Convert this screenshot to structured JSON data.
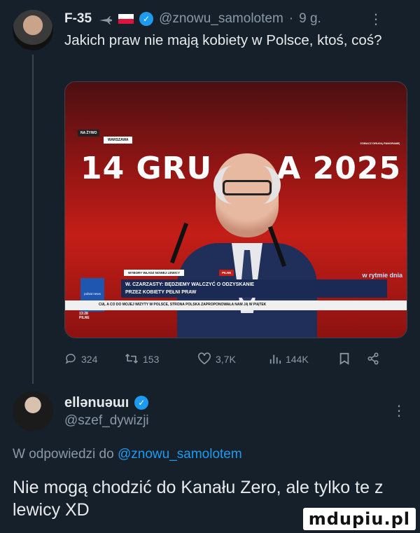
{
  "tweet": {
    "author_name": "F-35",
    "author_handle": "@znowu_samolotem",
    "time": "9 g.",
    "text": "Jakich praw nie mają kobiety w Polsce, ktoś, coś?",
    "media": {
      "live_label": "NA ŻYWO",
      "location": "WARSZAWA",
      "channel_note": "ZOBACZ DRUGĄ PANORAMĘ",
      "date_left": "14 GRU",
      "date_right": "A 2025",
      "ticker_tag": "WYBORY WŁADZ NOWEJ LEWICY",
      "ticker_tag2": "PILNE",
      "ticker_line1": "W. CZARZASTY: BĘDZIEMY WALCZYĆ O ODZYSKANIE",
      "ticker_line2": "PRZEZ KOBIETY PEŁNI PRAW",
      "ticker_small": "CIĄ. A CO DO MOJEJ WIZYTY W POLSCE, STRONA POLSKA ZAPROPONOWAŁA NAM JĄ W PIĄTEK",
      "logo_text": "polsat news",
      "time_text": "13:28",
      "pilne_small": "PILNE",
      "rhythm_text": "w rytmie dnia"
    },
    "stats": {
      "replies": "324",
      "reposts": "153",
      "likes": "3,7K",
      "views": "144K"
    }
  },
  "reply": {
    "author_name": "ellənuəɯı",
    "author_handle": "@szef_dywizji",
    "reply_to_prefix": "W odpowiedzi do",
    "reply_to_handle": "@znowu_samolotem",
    "text": "Nie mogą chodzić do Kanału Zero, ale tylko te z lewicy XD"
  },
  "watermark": "mdupiu.pl"
}
